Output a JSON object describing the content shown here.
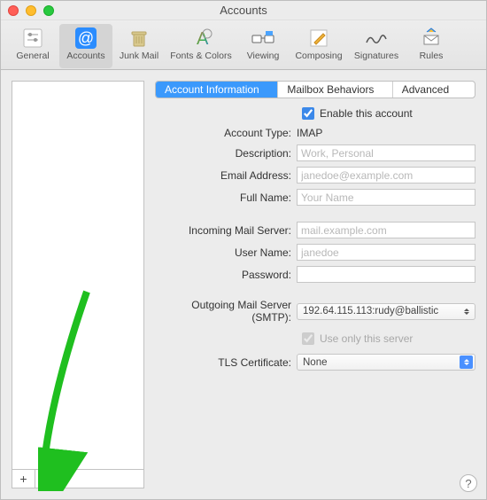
{
  "window": {
    "title": "Accounts"
  },
  "toolbar": {
    "items": [
      {
        "label": "General"
      },
      {
        "label": "Accounts"
      },
      {
        "label": "Junk Mail"
      },
      {
        "label": "Fonts & Colors"
      },
      {
        "label": "Viewing"
      },
      {
        "label": "Composing"
      },
      {
        "label": "Signatures"
      },
      {
        "label": "Rules"
      }
    ]
  },
  "tabs": {
    "info": "Account Information",
    "mailbox": "Mailbox Behaviors",
    "advanced": "Advanced"
  },
  "form": {
    "enable_label": "Enable this account",
    "enable_checked": true,
    "account_type_label": "Account Type:",
    "account_type_value": "IMAP",
    "description_label": "Description:",
    "description_placeholder": "Work, Personal",
    "description_value": "",
    "email_label": "Email Address:",
    "email_placeholder": "janedoe@example.com",
    "email_value": "",
    "fullname_label": "Full Name:",
    "fullname_placeholder": "Your Name",
    "fullname_value": "",
    "incoming_label": "Incoming Mail Server:",
    "incoming_placeholder": "mail.example.com",
    "incoming_value": "",
    "username_label": "User Name:",
    "username_placeholder": "janedoe",
    "username_value": "",
    "password_label": "Password:",
    "password_value": "",
    "smtp_label": "Outgoing Mail Server (SMTP):",
    "smtp_value": "192.64.115.113:rudy@ballistic",
    "use_only_label": "Use only this server",
    "use_only_checked": true,
    "tls_label": "TLS Certificate:",
    "tls_value": "None"
  },
  "buttons": {
    "add": "+",
    "remove": "−",
    "help": "?"
  }
}
